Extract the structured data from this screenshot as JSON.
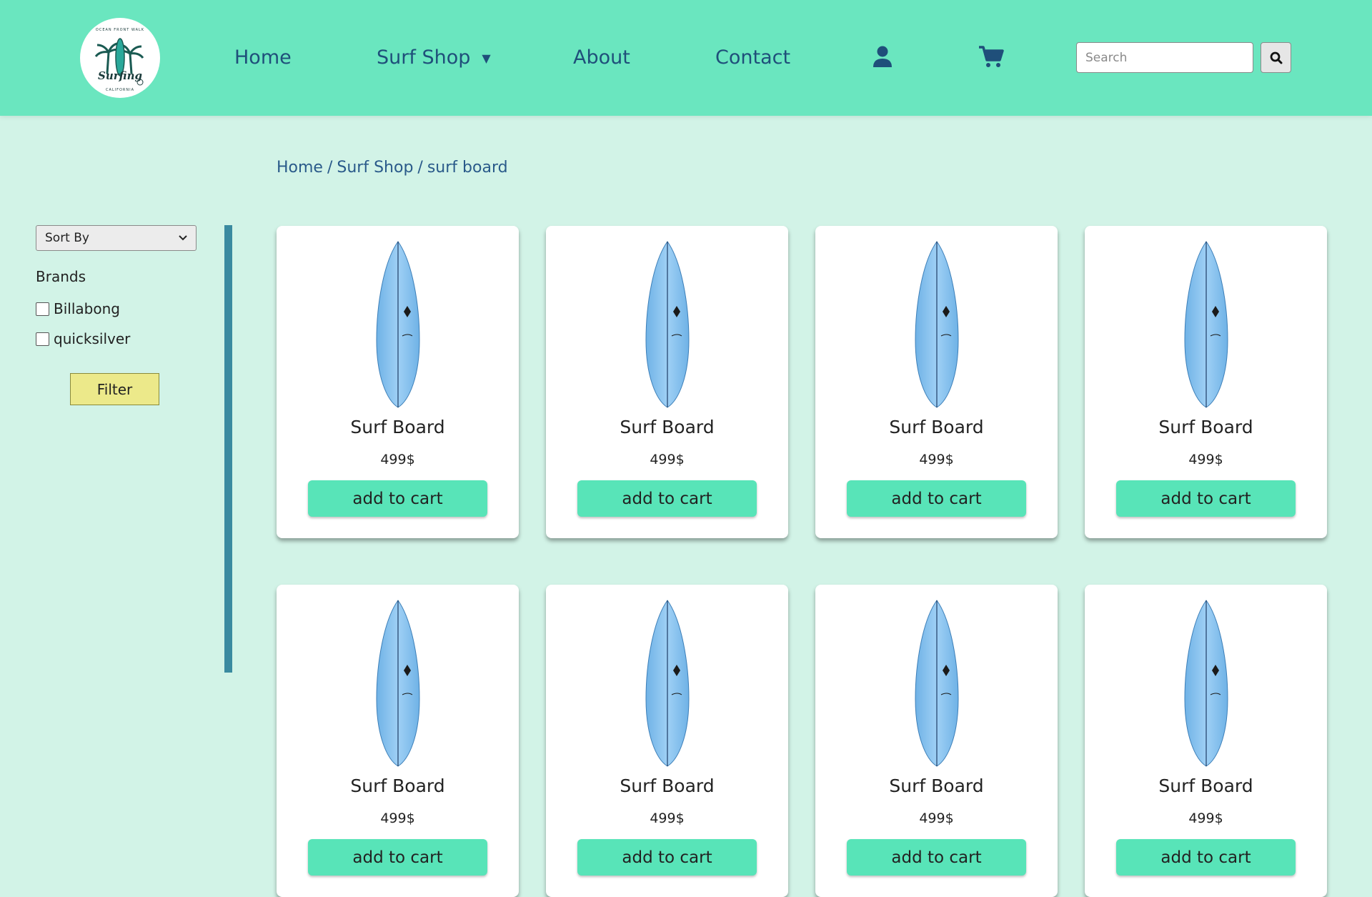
{
  "header": {
    "logo_text": "Surfing",
    "logo_ring_text": "OCEAN FRONT WALK",
    "logo_bottom_text": "CALIFORNIA",
    "nav": {
      "home": "Home",
      "surf_shop": "Surf Shop",
      "about": "About",
      "contact": "Contact"
    },
    "icons": {
      "account": "user-icon",
      "cart": "cart-icon",
      "search": "search-icon",
      "dropdown": "caret-down-icon"
    },
    "search": {
      "placeholder": "Search",
      "value": ""
    }
  },
  "breadcrumb": {
    "items": [
      "Home",
      "Surf Shop",
      "surf board"
    ],
    "separator": "/"
  },
  "sidebar": {
    "sort": {
      "selected": "Sort By"
    },
    "brands_title": "Brands",
    "brands": [
      {
        "label": "Billabong",
        "checked": false
      },
      {
        "label": "quicksilver",
        "checked": false
      }
    ],
    "filter_label": "Filter"
  },
  "products": [
    {
      "name": "Surf Board",
      "price": "499$",
      "button": "add to cart"
    },
    {
      "name": "Surf Board",
      "price": "499$",
      "button": "add to cart"
    },
    {
      "name": "Surf Board",
      "price": "499$",
      "button": "add to cart"
    },
    {
      "name": "Surf Board",
      "price": "499$",
      "button": "add to cart"
    },
    {
      "name": "Surf Board",
      "price": "499$",
      "button": "add to cart"
    },
    {
      "name": "Surf Board",
      "price": "499$",
      "button": "add to cart"
    },
    {
      "name": "Surf Board",
      "price": "499$",
      "button": "add to cart"
    },
    {
      "name": "Surf Board",
      "price": "499$",
      "button": "add to cart"
    }
  ],
  "colors": {
    "header_bg": "#6ae6bf",
    "page_bg": "#d2f3e7",
    "nav_text": "#1f4f7a",
    "accent_button": "#58e4b8",
    "filter_button": "#ece98a",
    "divider": "#3a8aa0",
    "board": "#7ec0ee"
  }
}
